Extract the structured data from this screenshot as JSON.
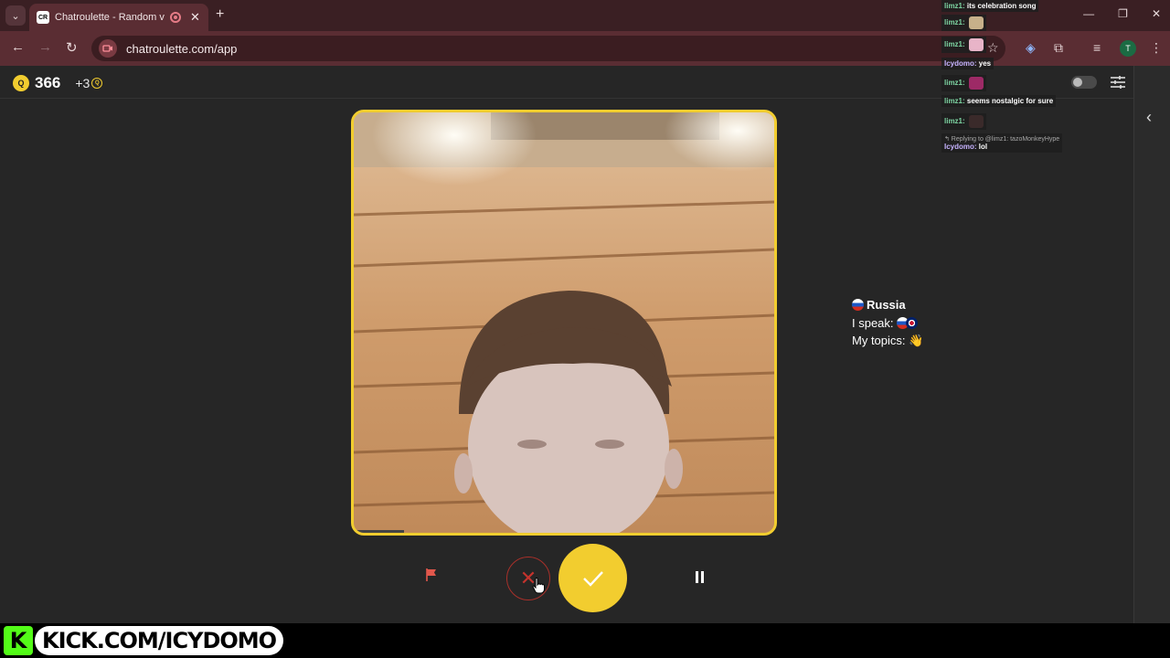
{
  "browser": {
    "tab_title": "Chatroulette - Random vide",
    "tab_favicon_text": "CR",
    "url": "chatroulette.com/app",
    "profile_initial": "T"
  },
  "header": {
    "coins": "366",
    "bonus": "+3",
    "coin_glyph": "Q"
  },
  "partner": {
    "country": "Russia",
    "speak_label": "I speak:",
    "topics_label": "My topics:",
    "topics_emoji": "👋"
  },
  "chat": [
    {
      "user": "limz1:",
      "text": "its celebration song",
      "user_color": "green"
    },
    {
      "user": "limz1:",
      "text": "",
      "emote": "#c7b08a",
      "user_color": "green"
    },
    {
      "user": "limz1:",
      "text": "",
      "emote": "#e8b4c8",
      "user_color": "green"
    },
    {
      "user": "Icydomo:",
      "text": "yes",
      "user_color": "purple"
    },
    {
      "user": "limz1:",
      "text": "",
      "emote": "#9d2a66",
      "user_color": "green"
    },
    {
      "user": "limz1:",
      "text": "seems nostalgic for sure",
      "user_color": "green"
    },
    {
      "user": "limz1:",
      "text": "",
      "emote": "#3a2a2a",
      "user_color": "green"
    },
    {
      "reply": "Replying to @limz1: tazoMonkeyHype",
      "user": "Icydomo:",
      "text": "lol",
      "user_color": "purple"
    }
  ],
  "overlay": {
    "kick_logo": "K",
    "kick_text": "KICK.COM/ICYDOMO"
  },
  "colors": {
    "accent": "#f2cd2f",
    "skip": "#c4332d",
    "kick_green": "#53fc18"
  }
}
